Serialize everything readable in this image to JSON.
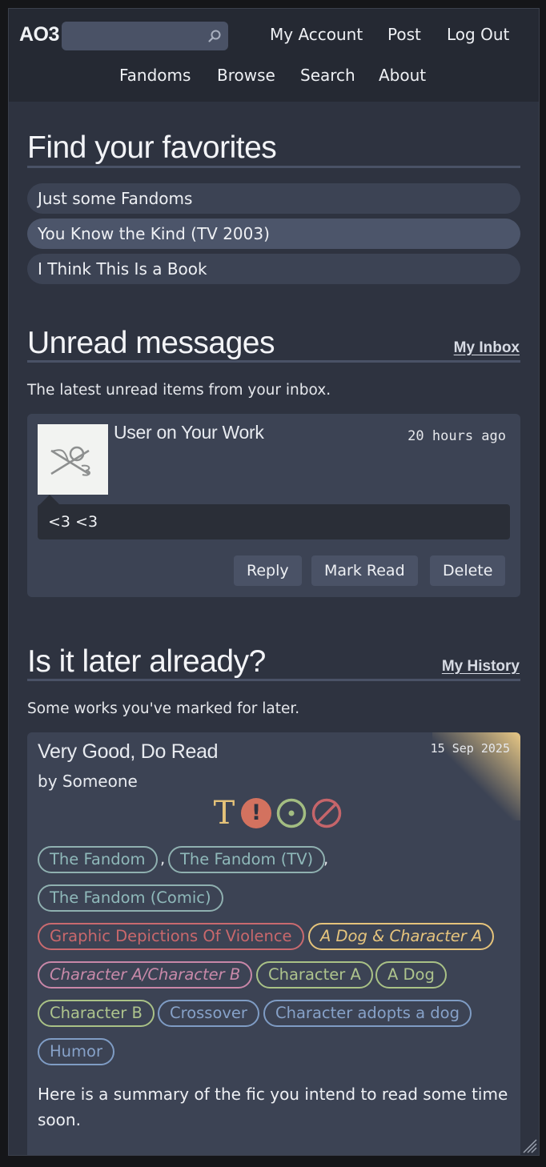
{
  "header": {
    "logo": "AO3",
    "search": {
      "value": "",
      "placeholder": ""
    },
    "user_links": [
      "My Account",
      "Post",
      "Log Out"
    ],
    "main_links": [
      "Fandoms",
      "Browse",
      "Search",
      "About"
    ]
  },
  "favorites": {
    "title": "Find your favorites",
    "items": [
      "Just some Fandoms",
      "You Know the Kind (TV 2003)",
      "I Think This Is a Book"
    ]
  },
  "messages": {
    "title": "Unread messages",
    "link": "My Inbox",
    "intro": "The latest unread items from your inbox.",
    "item": {
      "from": "User on Your Work",
      "time": "20 hours ago",
      "body": "<3 <3",
      "actions": [
        "Reply",
        "Mark Read",
        "Delete"
      ]
    }
  },
  "later": {
    "title": "Is it later already?",
    "link": "My History",
    "intro": "Some works you've marked for later.",
    "work": {
      "title": "Very Good, Do Read",
      "by_prefix": "by",
      "author": "Someone",
      "date": "15 Sep 2025",
      "fandoms": [
        "The Fandom",
        "The Fandom (TV)",
        "The Fandom (Comic)"
      ],
      "separator": ",",
      "warnings": [
        "Graphic Depictions Of Violence"
      ],
      "relationships": [
        "A Dog & Character A",
        "Character A/Character B"
      ],
      "characters": [
        "Character A",
        "A Dog",
        "Character B"
      ],
      "freeforms": [
        "Crossover",
        "Character adopts a dog",
        "Humor"
      ],
      "summary": "Here is a summary of the fic you intend to read some time soon.",
      "symbols": {
        "rating": "T",
        "warning": "!",
        "colors": {
          "rating": "#e4c279",
          "warning": "#d3725f",
          "category": "#a3bd82",
          "complete": "#c5656a"
        }
      }
    }
  }
}
